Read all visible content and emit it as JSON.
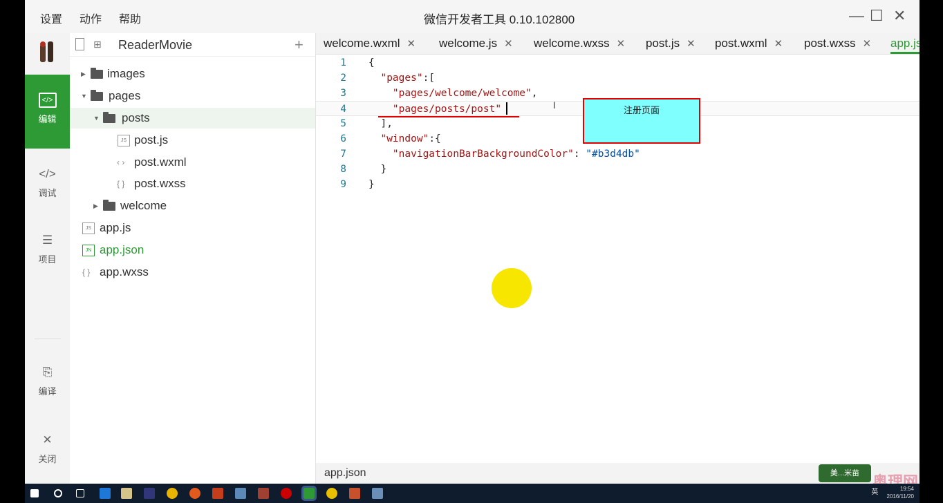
{
  "window": {
    "title": "微信开发者工具 0.10.102800",
    "menu": [
      "设置",
      "动作",
      "帮助"
    ],
    "controls": {
      "minimize": "—",
      "maximize": "☐",
      "close": "✕"
    }
  },
  "nav": {
    "items": [
      {
        "label": "编辑",
        "icon": "code-icon",
        "glyph": "</>",
        "active": true
      },
      {
        "label": "调试",
        "icon": "debug-icon",
        "glyph": "</>"
      },
      {
        "label": "项目",
        "icon": "menu-icon",
        "glyph": "☰"
      },
      {
        "label": "编译",
        "icon": "compile-icon",
        "glyph": "⎘"
      },
      {
        "label": "关闭",
        "icon": "close-icon",
        "glyph": "✕"
      }
    ]
  },
  "tree": {
    "project": "ReaderMovie",
    "add": "+",
    "items": [
      {
        "name": "images",
        "type": "folder",
        "expanded": false
      },
      {
        "name": "pages",
        "type": "folder",
        "expanded": true
      },
      {
        "name": "posts",
        "type": "folder",
        "expanded": true,
        "selected": true
      },
      {
        "name": "post.js",
        "type": "js",
        "badge": "JS"
      },
      {
        "name": "post.wxml",
        "type": "wxml",
        "badge": "‹ ›"
      },
      {
        "name": "post.wxss",
        "type": "wxss",
        "badge": "{ }"
      },
      {
        "name": "welcome",
        "type": "folder",
        "expanded": false
      },
      {
        "name": "app.js",
        "type": "js",
        "badge": "JS"
      },
      {
        "name": "app.json",
        "type": "json",
        "badge": "JN",
        "active": true
      },
      {
        "name": "app.wxss",
        "type": "wxss",
        "badge": "{ }"
      }
    ]
  },
  "tabs": [
    {
      "label": "welcome.wxml",
      "close": "✕"
    },
    {
      "label": "welcome.js",
      "close": "✕"
    },
    {
      "label": "welcome.wxss",
      "close": "✕"
    },
    {
      "label": "post.js",
      "close": "✕"
    },
    {
      "label": "post.wxml",
      "close": "✕"
    },
    {
      "label": "post.wxss",
      "close": "✕"
    },
    {
      "label": "app.js",
      "close": "",
      "active": true
    }
  ],
  "code": {
    "lines": [
      "1",
      "2",
      "3",
      "4",
      "5",
      "6",
      "7",
      "8",
      "9"
    ],
    "l1": "{",
    "l2_key": "\"pages\"",
    "l2_rest": ":[",
    "l3": "\"pages/welcome/welcome\"",
    "l3_rest": ",",
    "l4": "\"pages/posts/post\"",
    "l5": "],",
    "l6_key": "\"window\"",
    "l6_rest": ":{",
    "l7_key": "\"navigationBarBackgroundColor\"",
    "l7_sep": ": ",
    "l7_val": "\"#b3d4db\"",
    "l8": "}",
    "l9": "}"
  },
  "annotation": "注册页面",
  "ibeam": "I",
  "status": {
    "file": "app.json"
  },
  "taskbar": {
    "time": "19:54",
    "date": "2016/11/20",
    "ime": "英"
  },
  "watermark": {
    "badge": "美...米苗",
    "text": "奥理网"
  }
}
